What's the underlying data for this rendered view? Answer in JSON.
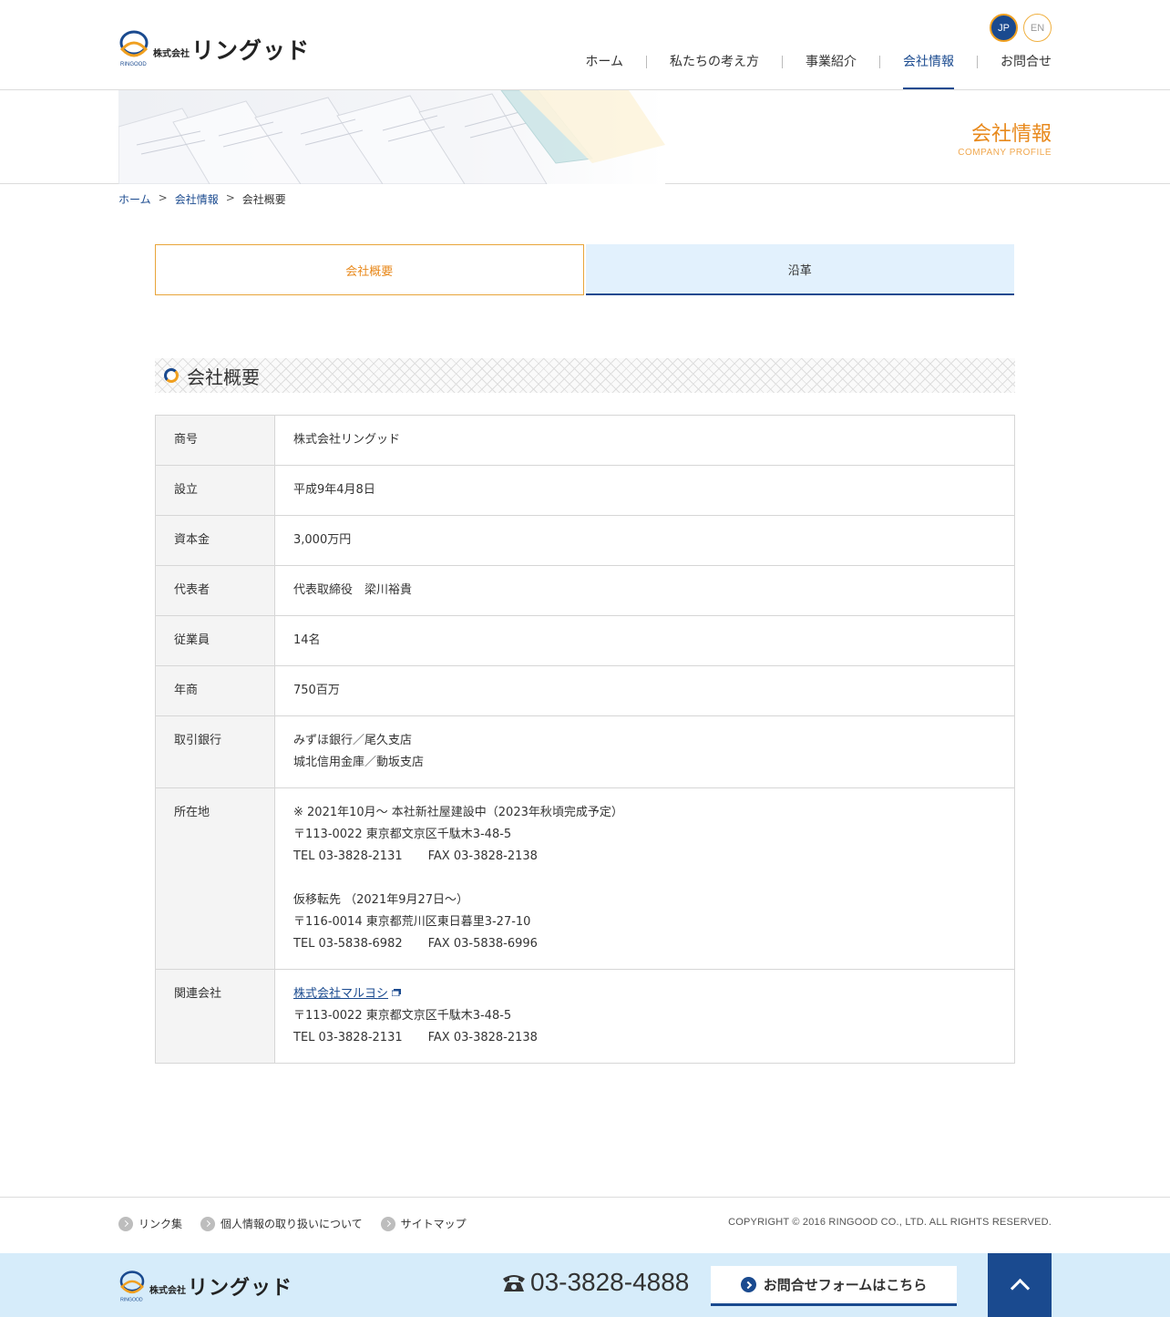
{
  "header": {
    "logo_small": "株式会社",
    "logo_big": "リングッド",
    "logo_sub": "RINGOOD",
    "lang_jp": "JP",
    "lang_en": "EN",
    "nav": [
      {
        "label": "ホーム"
      },
      {
        "label": "私たちの考え方"
      },
      {
        "label": "事業紹介"
      },
      {
        "label": "会社情報"
      },
      {
        "label": "お問合せ"
      }
    ]
  },
  "banner": {
    "title": "会社情報",
    "subtitle": "COMPANY PROFILE"
  },
  "breadcrumb": {
    "home": "ホーム",
    "sep": ">",
    "company": "会社情報",
    "current": "会社概要"
  },
  "tabs": {
    "overview": "会社概要",
    "history": "沿革"
  },
  "section": {
    "title": "会社概要"
  },
  "table": {
    "rows": [
      {
        "label": "商号",
        "lines": [
          "株式会社リングッド"
        ]
      },
      {
        "label": "設立",
        "lines": [
          "平成9年4月8日"
        ]
      },
      {
        "label": "資本金",
        "lines": [
          "3,000万円"
        ]
      },
      {
        "label": "代表者",
        "lines": [
          "代表取締役　梁川裕貴"
        ]
      },
      {
        "label": "従業員",
        "lines": [
          "14名"
        ]
      },
      {
        "label": "年商",
        "lines": [
          "750百万"
        ]
      },
      {
        "label": "取引銀行",
        "lines": [
          "みずほ銀行／尾久支店",
          "城北信用金庫／動坂支店"
        ]
      }
    ],
    "location": {
      "label": "所在地",
      "note": "※ 2021年10月～ 本社新社屋建設中（2023年秋頃完成予定）",
      "address": "〒113-0022 東京都文京区千駄木3-48-5",
      "tel": "TEL 03-3828-2131",
      "fax": "FAX 03-3828-2138",
      "temp_title": "仮移転先 （2021年9月27日～）",
      "temp_address": "〒116-0014 東京都荒川区東日暮里3-27-10",
      "temp_tel": "TEL 03-5838-6982",
      "temp_fax": "FAX 03-5838-6996"
    },
    "related": {
      "label": "関連会社",
      "company": "株式会社マルヨシ",
      "address": "〒113-0022 東京都文京区千駄木3-48-5",
      "tel": "TEL 03-3828-2131",
      "fax": "FAX 03-3828-2138"
    }
  },
  "footer": {
    "links": [
      "リンク集",
      "個人情報の取り扱いについて",
      "サイトマップ"
    ],
    "copyright": "COPYRIGHT © 2016 RINGOOD CO., LTD. ALL RIGHTS RESERVED.",
    "phone": "03-3828-4888",
    "contact_button": "お問合せフォームはこちら"
  },
  "colors": {
    "brand_blue": "#1a4a8f",
    "accent_orange": "#e8891c",
    "tab_bg": "#e2f1fd",
    "footer_bg": "#d6ecfa"
  }
}
